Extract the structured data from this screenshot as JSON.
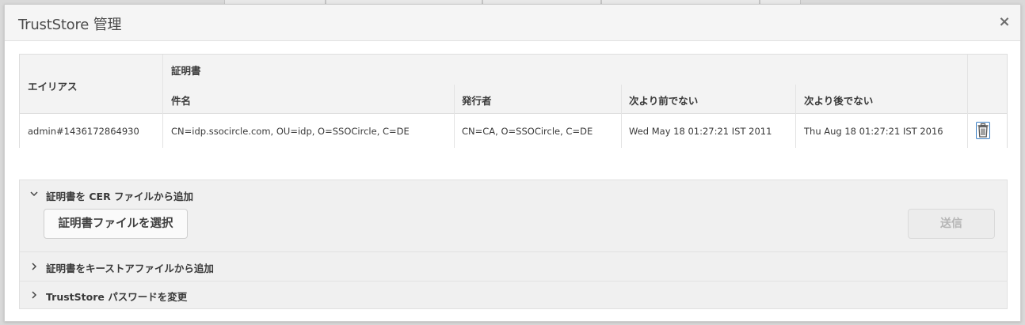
{
  "dialog": {
    "title": "TrustStore 管理",
    "close_label": "×"
  },
  "table": {
    "alias_header": "エイリアス",
    "certificate_group_header": "証明書",
    "columns": [
      "件名",
      "発行者",
      "次より前でない",
      "次より後でない"
    ],
    "rows": [
      {
        "alias": "admin#1436172864930",
        "subject": "CN=idp.ssocircle.com, OU=idp, O=SSOCircle, C=DE",
        "issuer": "CN=CA, O=SSOCircle, C=DE",
        "not_before": "Wed May 18 01:27:21 IST 2011",
        "not_after": "Thu Aug 18 01:27:21 IST 2016"
      }
    ],
    "delete_icon": "trash-icon",
    "accent_color": "#3b7fc4"
  },
  "accordion": {
    "sections": [
      {
        "label": "証明書を CER ファイルから追加",
        "expanded": true
      },
      {
        "label": "証明書をキーストアファイルから追加",
        "expanded": false
      },
      {
        "label": "TrustStore パスワードを変更",
        "expanded": false
      }
    ],
    "select_file_button": "証明書ファイルを選択",
    "submit_button": "送信"
  }
}
